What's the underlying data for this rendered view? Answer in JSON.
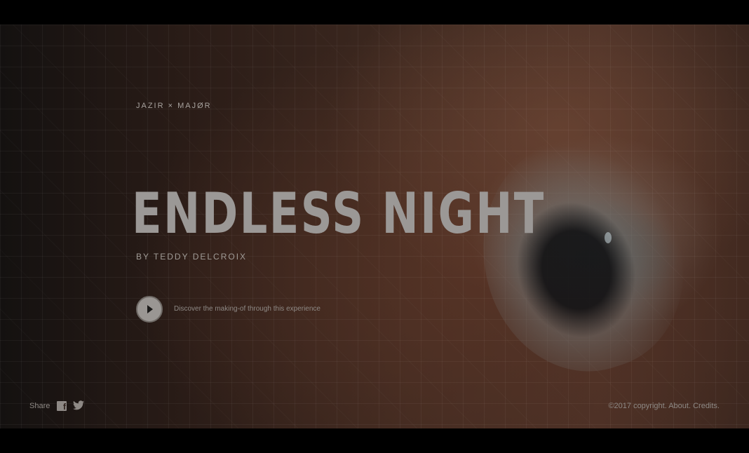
{
  "hero": {
    "brand": "JAZIR × MAJØR",
    "title": "ENDLESS NIGHT",
    "byline": "BY TEDDY DELCROIX",
    "play": {
      "icon": "play-icon",
      "caption": "Discover the making-of through this experience"
    }
  },
  "footer": {
    "share_label": "Share",
    "social": [
      {
        "icon": "facebook-icon"
      },
      {
        "icon": "twitter-icon"
      }
    ],
    "copyright": "©2017 copyright.",
    "about": "About.",
    "credits": "Credits."
  },
  "colors": {
    "background": "#000000",
    "text": "#a8a39f",
    "title": "#9b9896",
    "play_button": "#9a9693"
  }
}
